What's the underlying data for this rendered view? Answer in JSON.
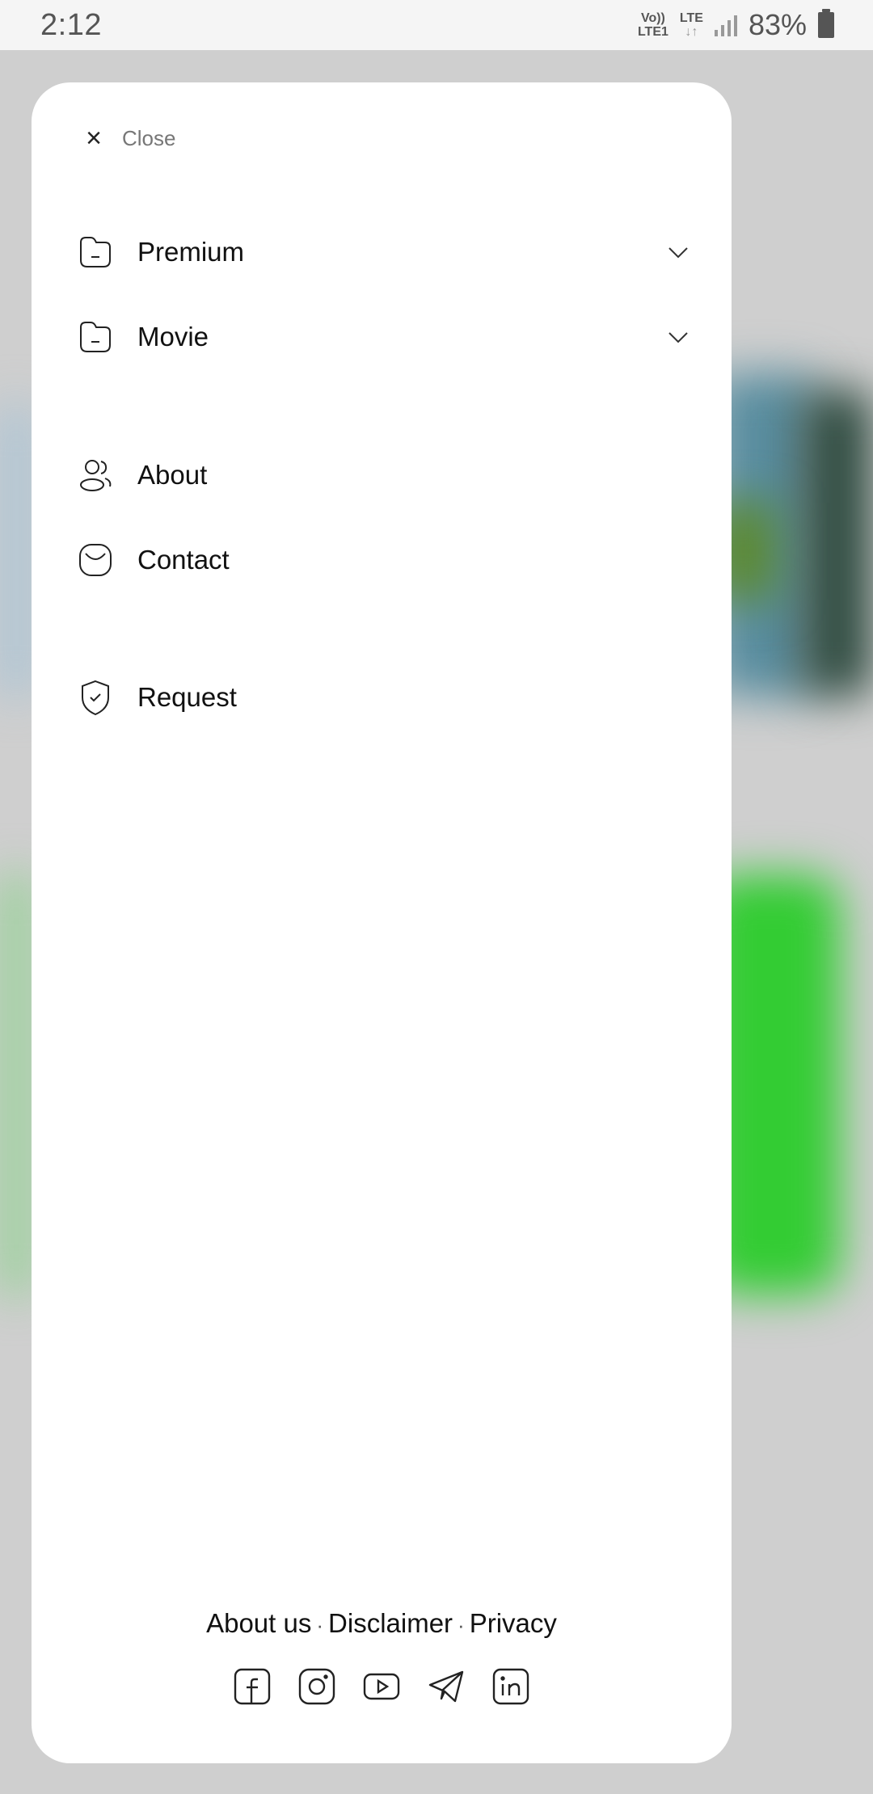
{
  "status_bar": {
    "time": "2:12",
    "network_volte": "Vo))",
    "network_lte1": "LTE1",
    "network_lte": "LTE",
    "battery_percent": "83%"
  },
  "drawer": {
    "close_label": "Close",
    "close_icon": "×",
    "menu": [
      {
        "label": "Premium",
        "icon": "folder-icon",
        "expandable": true
      },
      {
        "label": "Movie",
        "icon": "folder-icon",
        "expandable": true
      },
      {
        "label": "About",
        "icon": "users-icon",
        "expandable": false
      },
      {
        "label": "Contact",
        "icon": "mail-icon",
        "expandable": false
      },
      {
        "label": "Request",
        "icon": "shield-check-icon",
        "expandable": false
      }
    ],
    "footer": {
      "links": [
        "About us",
        "Disclaimer",
        "Privacy"
      ],
      "separator": "·",
      "social": [
        "facebook-icon",
        "instagram-icon",
        "youtube-icon",
        "telegram-icon",
        "linkedin-icon"
      ]
    }
  },
  "colors": {
    "drawer_bg": "#ffffff",
    "backdrop": "#c9c9c9",
    "text": "#111111",
    "muted": "#777777"
  }
}
